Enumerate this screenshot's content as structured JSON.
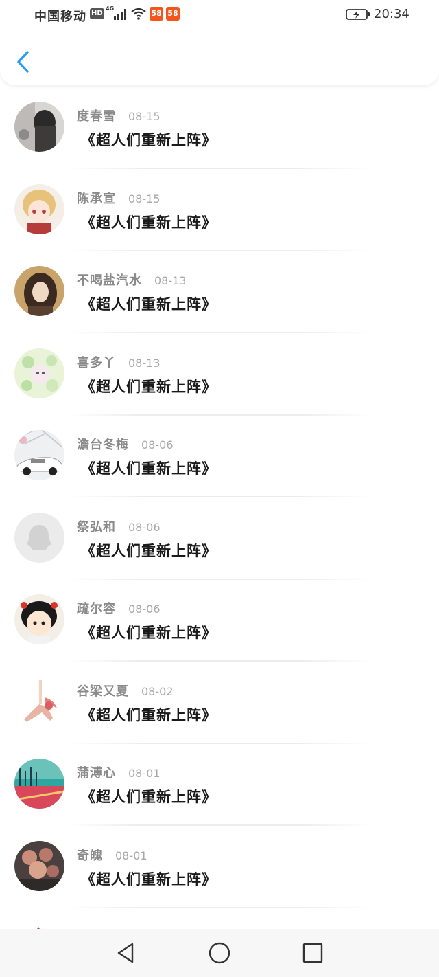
{
  "status_bar": {
    "carrier": "中国移动",
    "hd": "HD",
    "network": "4G",
    "app_badge_1": "58",
    "app_badge_2": "58",
    "time": "20:34"
  },
  "header": {
    "back_icon": "chevron-left-icon",
    "accent_color": "#2b9df0"
  },
  "messages": [
    {
      "name": "度春雪",
      "date": "08-15",
      "title": "《超人们重新上阵》"
    },
    {
      "name": "陈承宣",
      "date": "08-15",
      "title": "《超人们重新上阵》"
    },
    {
      "name": "不喝盐汽水",
      "date": "08-13",
      "title": "《超人们重新上阵》"
    },
    {
      "name": "喜多丫",
      "date": "08-13",
      "title": "《超人们重新上阵》"
    },
    {
      "name": "澹台冬梅",
      "date": "08-06",
      "title": "《超人们重新上阵》"
    },
    {
      "name": "祭弘和",
      "date": "08-06",
      "title": "《超人们重新上阵》"
    },
    {
      "name": "疏尔容",
      "date": "08-06",
      "title": "《超人们重新上阵》"
    },
    {
      "name": "谷梁又夏",
      "date": "08-02",
      "title": "《超人们重新上阵》"
    },
    {
      "name": "蒲溥心",
      "date": "08-01",
      "title": "《超人们重新上阵》"
    },
    {
      "name": "奇魄",
      "date": "08-01",
      "title": "《超人们重新上阵》"
    }
  ],
  "nav_bar": {
    "back_icon": "triangle-back-icon",
    "home_icon": "circle-home-icon",
    "recents_icon": "square-recents-icon"
  }
}
